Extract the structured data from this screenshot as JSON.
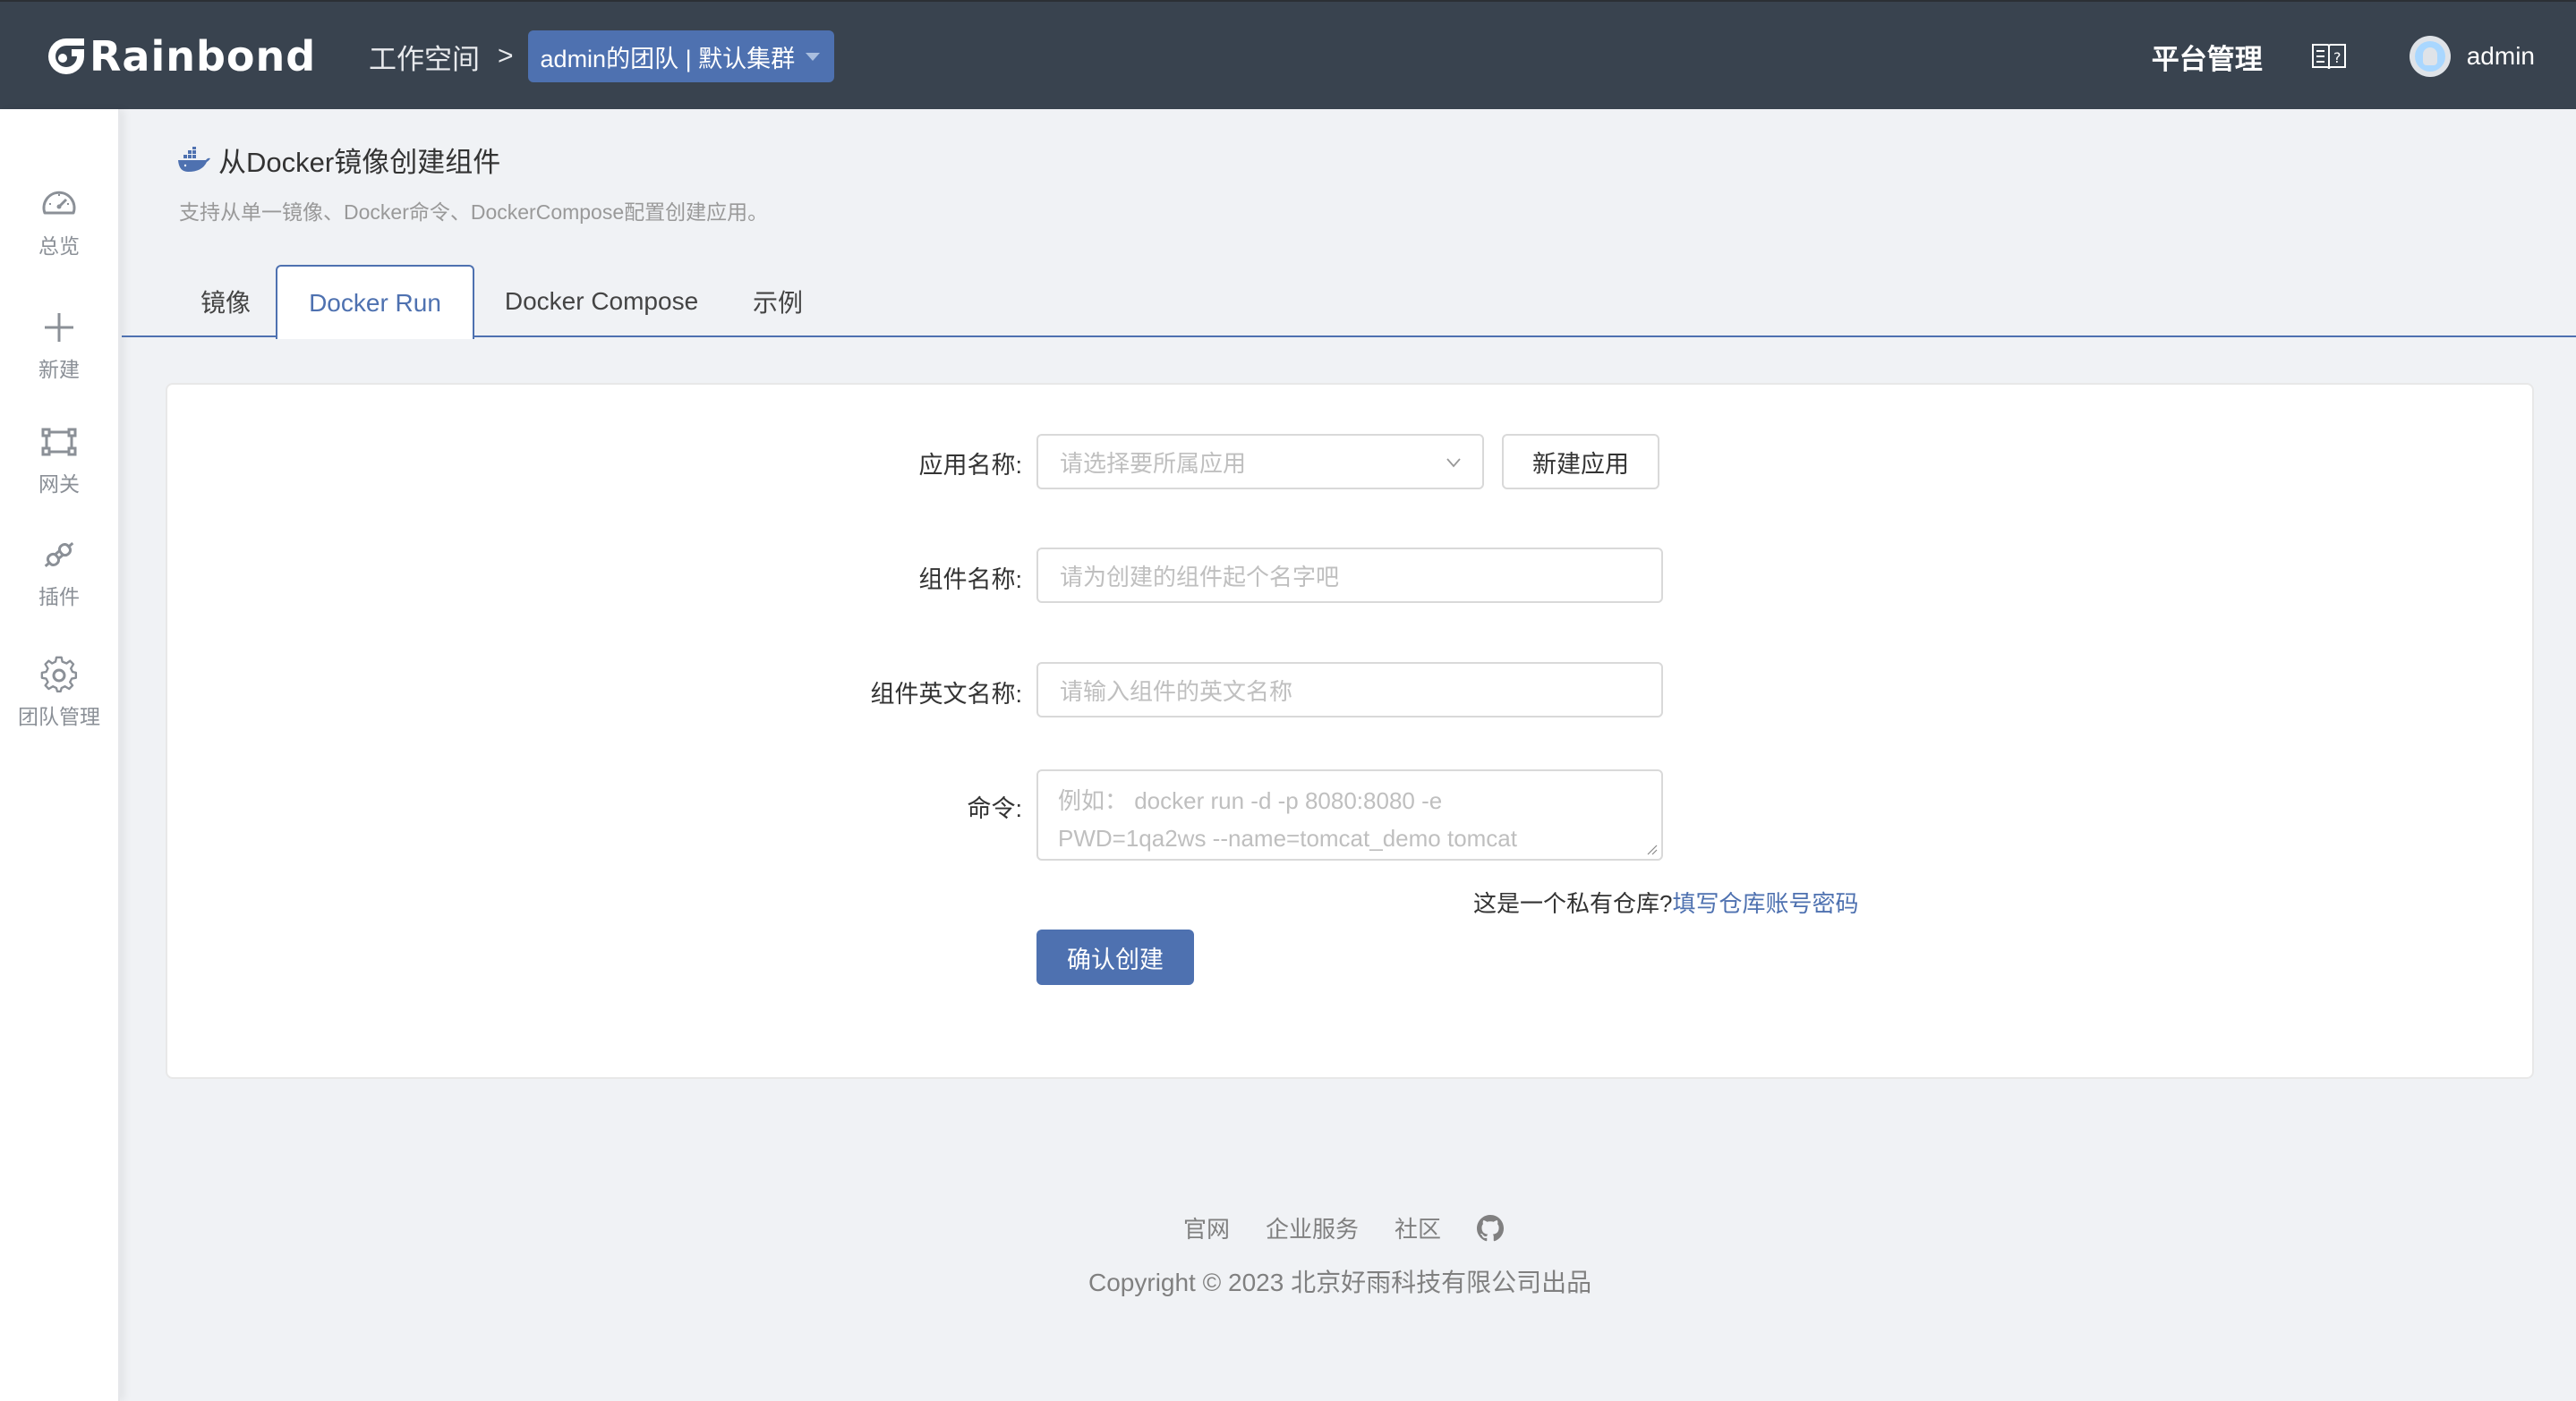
{
  "header": {
    "logo_text": "Rainbond",
    "breadcrumb_workspace": "工作空间",
    "breadcrumb_separator": ">",
    "team_selector": "admin的团队 | 默认集群",
    "platform_manage": "平台管理",
    "user_name": "admin"
  },
  "sidebar": {
    "items": [
      {
        "label": "总览",
        "icon": "dashboard-icon"
      },
      {
        "label": "新建",
        "icon": "plus-icon"
      },
      {
        "label": "网关",
        "icon": "gateway-icon"
      },
      {
        "label": "插件",
        "icon": "plugin-icon"
      },
      {
        "label": "团队管理",
        "icon": "gear-icon"
      }
    ]
  },
  "page": {
    "title": "从Docker镜像创建组件",
    "description": "支持从单一镜像、Docker命令、DockerCompose配置创建应用。"
  },
  "tabs": [
    {
      "label": "镜像",
      "active": false
    },
    {
      "label": "Docker Run",
      "active": true
    },
    {
      "label": "Docker Compose",
      "active": false
    },
    {
      "label": "示例",
      "active": false
    }
  ],
  "form": {
    "app_name_label": "应用名称:",
    "app_name_placeholder": "请选择要所属应用",
    "new_app_button": "新建应用",
    "component_name_label": "组件名称:",
    "component_name_placeholder": "请为创建的组件起个名字吧",
    "component_en_name_label": "组件英文名称:",
    "component_en_name_placeholder": "请输入组件的英文名称",
    "command_label": "命令:",
    "command_placeholder_line1": "例如：  docker run -d -p 8080:8080 -e",
    "command_placeholder_line2": "PWD=1qa2ws --name=tomcat_demo tomcat",
    "private_repo_question": "这是一个私有仓库?",
    "private_repo_link": "填写仓库账号密码",
    "submit_button": "确认创建"
  },
  "footer": {
    "links": [
      "官网",
      "企业服务",
      "社区"
    ],
    "copyright": "Copyright © 2023 北京好雨科技有限公司出品"
  },
  "colors": {
    "header_bg": "#39434f",
    "primary": "#4e71b0",
    "page_bg": "#f0f2f5"
  }
}
